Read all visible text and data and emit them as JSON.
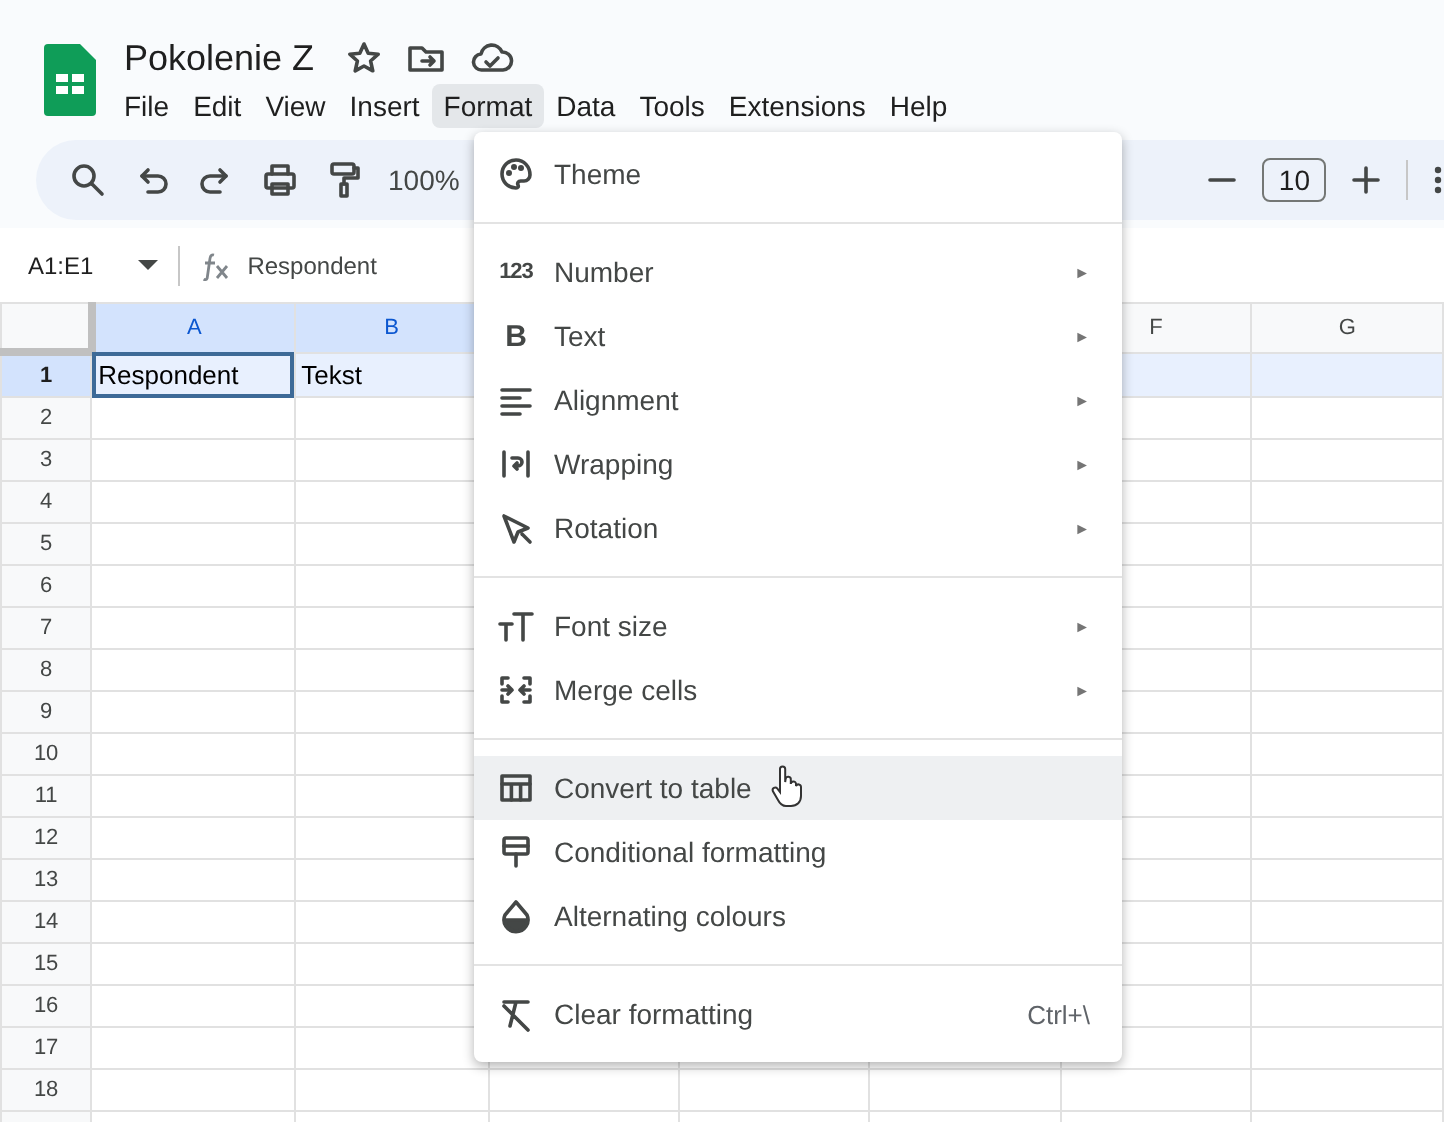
{
  "document": {
    "title": "Pokolenie Z"
  },
  "menu_bar": [
    {
      "label": "File",
      "selected": false
    },
    {
      "label": "Edit",
      "selected": false
    },
    {
      "label": "View",
      "selected": false
    },
    {
      "label": "Insert",
      "selected": false
    },
    {
      "label": "Format",
      "selected": true
    },
    {
      "label": "Data",
      "selected": false
    },
    {
      "label": "Tools",
      "selected": false
    },
    {
      "label": "Extensions",
      "selected": false
    },
    {
      "label": "Help",
      "selected": false
    }
  ],
  "toolbar": {
    "zoom": "100%",
    "font_size": "10"
  },
  "formula_bar": {
    "name_box": "A1:E1",
    "value": "Respondent"
  },
  "columns": [
    {
      "label": "A",
      "selected": true
    },
    {
      "label": "B",
      "selected": true
    },
    {},
    {},
    {},
    {
      "label": "F",
      "selected": false
    },
    {
      "label": "G",
      "selected": false
    }
  ],
  "rows": [
    {
      "number": "1",
      "selected": true,
      "cells": [
        "Respondent",
        "Tekst"
      ]
    },
    {
      "number": "2",
      "selected": false
    },
    {
      "number": "3",
      "selected": false
    },
    {
      "number": "4",
      "selected": false
    },
    {
      "number": "5",
      "selected": false
    },
    {
      "number": "6",
      "selected": false
    },
    {
      "number": "7",
      "selected": false
    },
    {
      "number": "8",
      "selected": false
    },
    {
      "number": "9",
      "selected": false
    },
    {
      "number": "10",
      "selected": false
    },
    {
      "number": "11",
      "selected": false
    },
    {
      "number": "12",
      "selected": false
    },
    {
      "number": "13",
      "selected": false
    },
    {
      "number": "14",
      "selected": false
    },
    {
      "number": "15",
      "selected": false
    },
    {
      "number": "16",
      "selected": false
    },
    {
      "number": "17",
      "selected": false
    },
    {
      "number": "18",
      "selected": false
    }
  ],
  "format_menu": {
    "sections": [
      [
        {
          "label": "Theme",
          "kind": "plain",
          "highlighted": false
        }
      ],
      [
        {
          "label": "Number",
          "kind": "submenu",
          "arrow": "►",
          "icon_text": "123",
          "highlighted": false
        },
        {
          "label": "Text",
          "kind": "submenu",
          "arrow": "►",
          "icon_text": "B",
          "highlighted": false
        },
        {
          "label": "Alignment",
          "kind": "submenu",
          "arrow": "►",
          "highlighted": false
        },
        {
          "label": "Wrapping",
          "kind": "submenu",
          "arrow": "►",
          "highlighted": false
        },
        {
          "label": "Rotation",
          "kind": "submenu",
          "arrow": "►",
          "highlighted": false
        }
      ],
      [
        {
          "label": "Font size",
          "kind": "submenu",
          "arrow": "►",
          "highlighted": false
        },
        {
          "label": "Merge cells",
          "kind": "submenu",
          "arrow": "►",
          "highlighted": false
        }
      ],
      [
        {
          "label": "Convert to table",
          "kind": "plain",
          "highlighted": true
        },
        {
          "label": "Conditional formatting",
          "kind": "plain",
          "highlighted": false
        },
        {
          "label": "Alternating colours",
          "kind": "plain",
          "highlighted": false
        }
      ],
      [
        {
          "label": "Clear formatting",
          "kind": "shortcut",
          "shortcut": "Ctrl+\\",
          "highlighted": false
        }
      ]
    ]
  }
}
